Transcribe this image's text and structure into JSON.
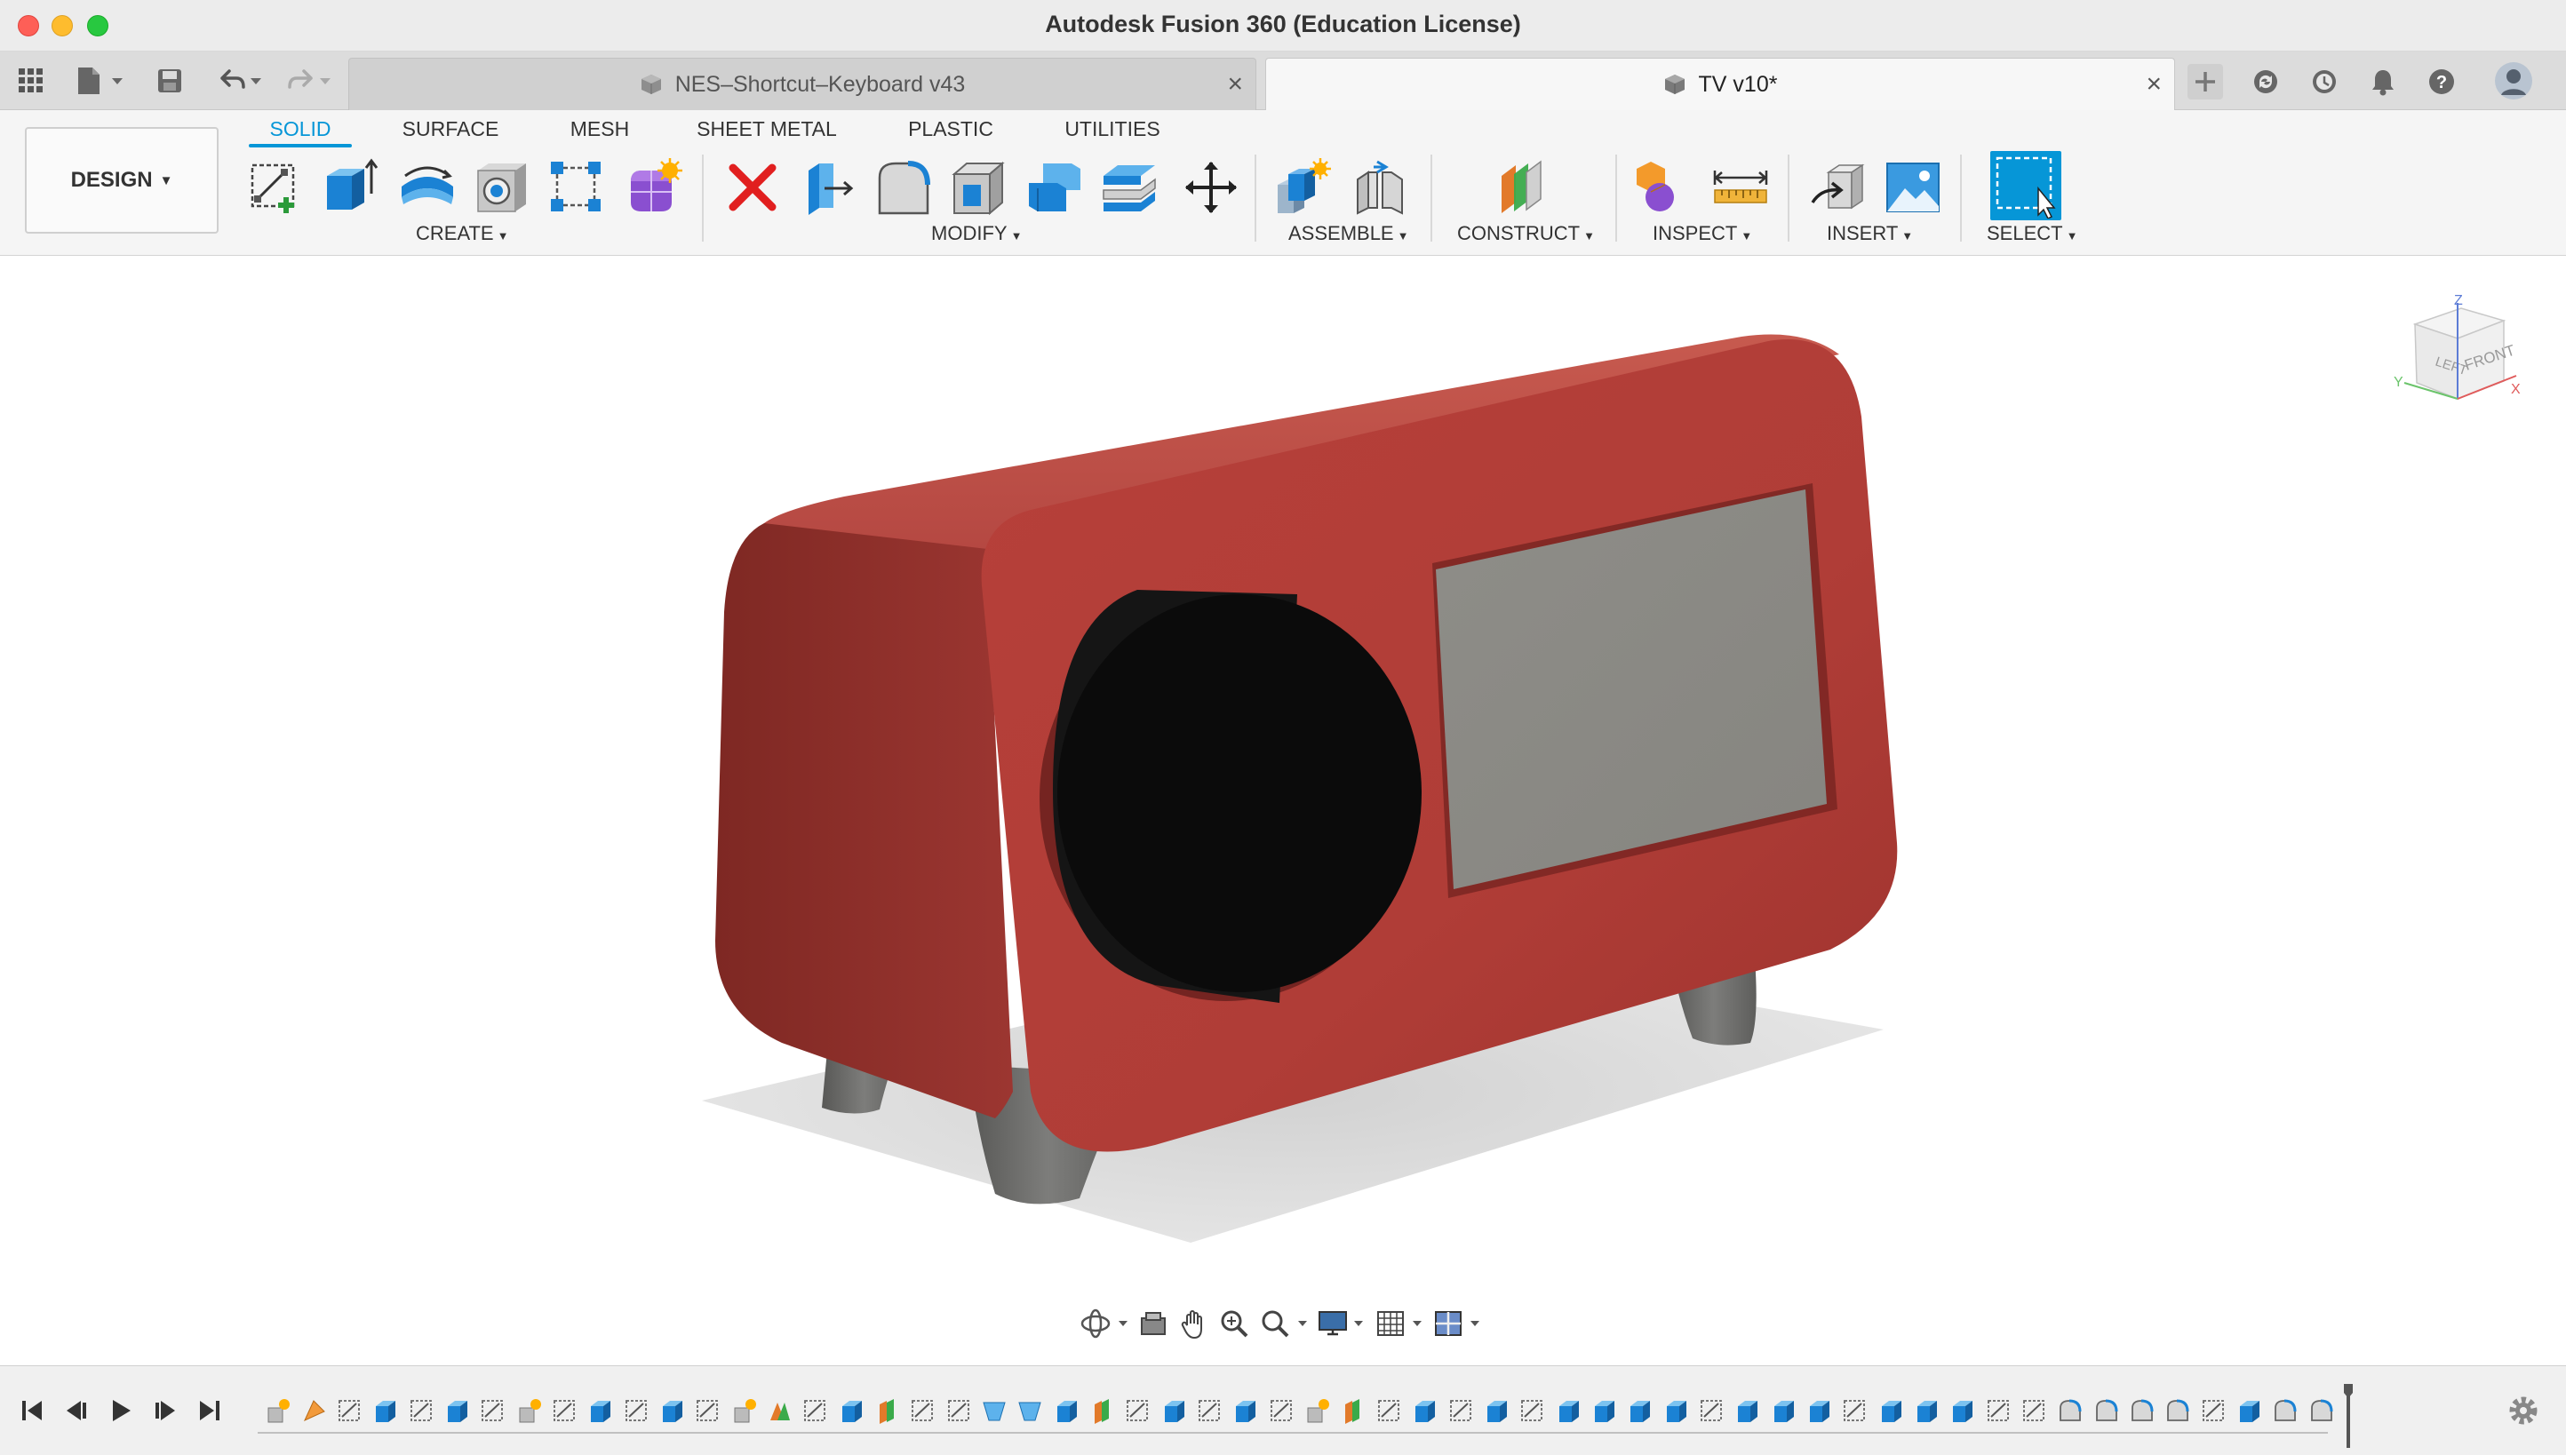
{
  "window": {
    "title": "Autodesk Fusion 360 (Education License)"
  },
  "tabs": [
    {
      "label": "NES–Shortcut–Keyboard v43",
      "active": false
    },
    {
      "label": "TV v10*",
      "active": true
    }
  ],
  "workspace": {
    "label": "DESIGN"
  },
  "workspace_tabs": [
    {
      "label": "SOLID",
      "active": true
    },
    {
      "label": "SURFACE",
      "active": false
    },
    {
      "label": "MESH",
      "active": false
    },
    {
      "label": "SHEET METAL",
      "active": false
    },
    {
      "label": "PLASTIC",
      "active": false
    },
    {
      "label": "UTILITIES",
      "active": false
    }
  ],
  "tool_groups": {
    "create": "CREATE",
    "modify": "MODIFY",
    "assemble": "ASSEMBLE",
    "construct": "CONSTRUCT",
    "inspect": "INSPECT",
    "insert": "INSERT",
    "select": "SELECT"
  },
  "viewcube": {
    "left": "LEFT",
    "front": "FRONT",
    "axis_x": "X",
    "axis_y": "Y",
    "axis_z": "Z"
  },
  "colors": {
    "accent": "#0696d7",
    "tv_body": "#b23a34",
    "tv_screen": "#8a8984",
    "knob": "#0b0b0b",
    "feet": "#6f6f6d"
  }
}
